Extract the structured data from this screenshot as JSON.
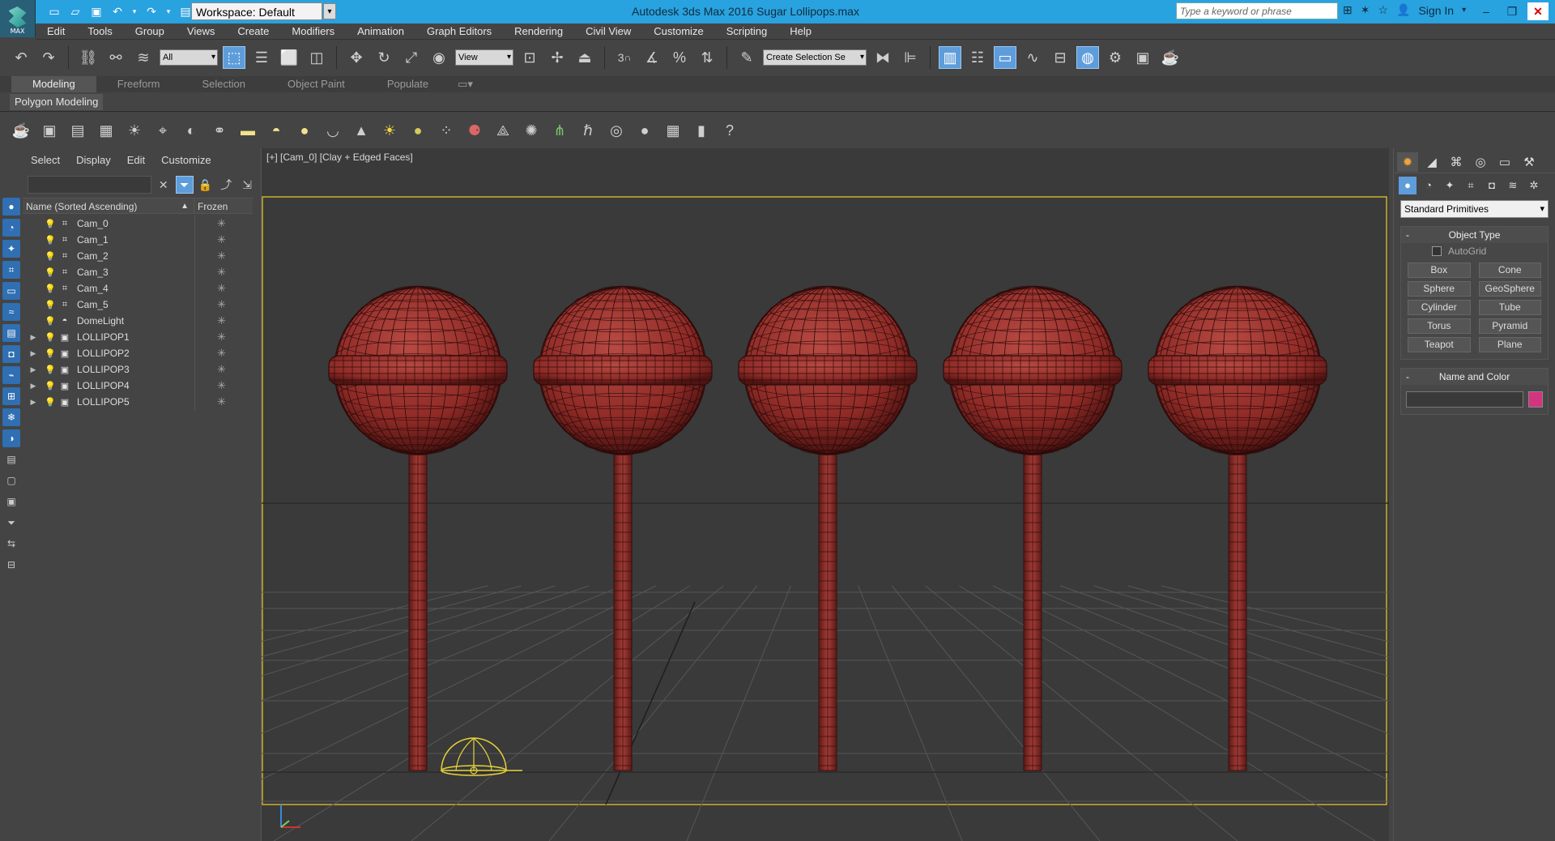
{
  "titlebar": {
    "logo_label": "MAX",
    "workspace": "Workspace: Default",
    "app_title": "Autodesk 3ds Max 2016     Sugar Lollipops.max",
    "search_placeholder": "Type a keyword or phrase",
    "sign_in": "Sign In"
  },
  "menu": [
    "Edit",
    "Tools",
    "Group",
    "Views",
    "Create",
    "Modifiers",
    "Animation",
    "Graph Editors",
    "Rendering",
    "Civil View",
    "Customize",
    "Scripting",
    "Help"
  ],
  "toolbar": {
    "selection_filter": "All",
    "ref_coord": "View",
    "named_selection": "Create Selection Se",
    "angle_snap": "3",
    "percent_snap": "%"
  },
  "ribbon": {
    "tabs": [
      "Modeling",
      "Freeform",
      "Selection",
      "Object Paint",
      "Populate"
    ],
    "active_tab": "Modeling",
    "panel_label": "Polygon Modeling"
  },
  "explorer": {
    "menu": [
      "Select",
      "Display",
      "Edit",
      "Customize"
    ],
    "col_name": "Name (Sorted Ascending)",
    "col_frozen": "Frozen",
    "sort_arrow": "▲",
    "rows": [
      {
        "name": "Cam_0",
        "type": "camera",
        "expandable": false
      },
      {
        "name": "Cam_1",
        "type": "camera",
        "expandable": false
      },
      {
        "name": "Cam_2",
        "type": "camera",
        "expandable": false
      },
      {
        "name": "Cam_3",
        "type": "camera",
        "expandable": false
      },
      {
        "name": "Cam_4",
        "type": "camera",
        "expandable": false
      },
      {
        "name": "Cam_5",
        "type": "camera",
        "expandable": false
      },
      {
        "name": "DomeLight",
        "type": "light",
        "expandable": false
      },
      {
        "name": "LOLLIPOP1",
        "type": "group",
        "expandable": true
      },
      {
        "name": "LOLLIPOP2",
        "type": "group",
        "expandable": true
      },
      {
        "name": "LOLLIPOP3",
        "type": "group",
        "expandable": true
      },
      {
        "name": "LOLLIPOP4",
        "type": "group",
        "expandable": true
      },
      {
        "name": "LOLLIPOP5",
        "type": "group",
        "expandable": true
      }
    ]
  },
  "viewport": {
    "label": "[+] [Cam_0] [Clay + Edged Faces]",
    "lollipop_count": 5,
    "lollipop_color": "#8e2a26",
    "safe_frame_color": "#c9b12a",
    "gizmo_x_color": "#cc3333",
    "gizmo_y_color": "#3a8ad6"
  },
  "command_panel": {
    "category": "Standard Primitives",
    "object_type_title": "Object Type",
    "autogrid_label": "AutoGrid",
    "buttons": [
      "Box",
      "Cone",
      "Sphere",
      "GeoSphere",
      "Cylinder",
      "Tube",
      "Torus",
      "Pyramid",
      "Teapot",
      "Plane"
    ],
    "name_color_title": "Name and Color",
    "object_color": "#d2347f"
  }
}
